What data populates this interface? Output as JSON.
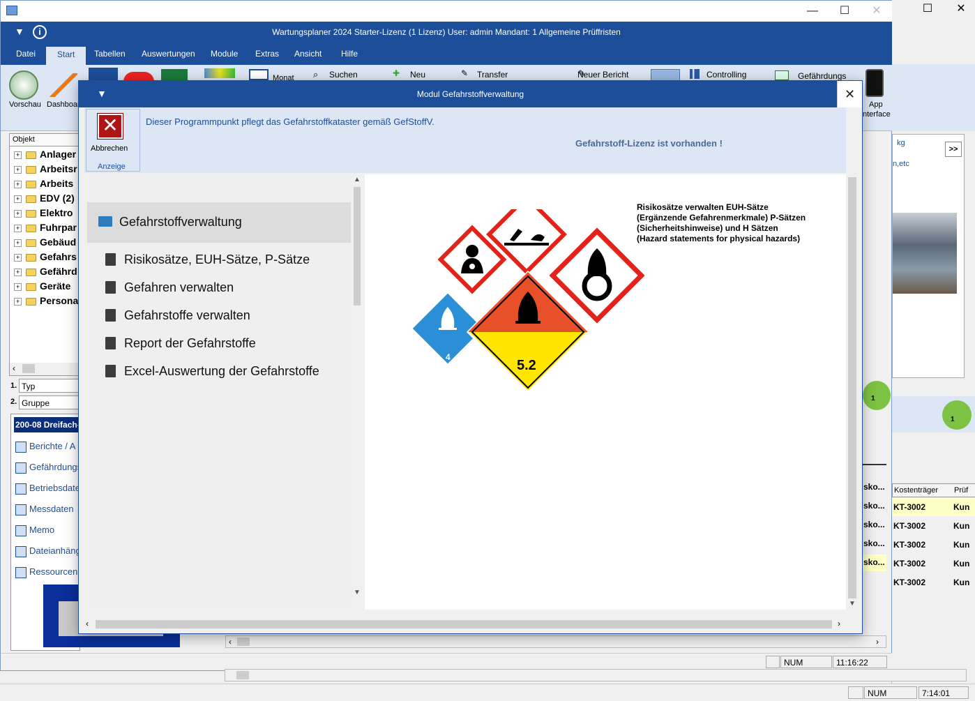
{
  "window": {
    "title": "Wartungsplaner 2024 Starter-Lizenz (1 Lizenz)   User: admin   Mandant: 1 Allgemeine Prüffristen"
  },
  "menu": [
    "Datei",
    "Start",
    "Tabellen",
    "Auswertungen",
    "Module",
    "Extras",
    "Ansicht",
    "Hilfe"
  ],
  "ribbon": {
    "vorschau": "Vorschau",
    "dashboard": "Dashboar",
    "monat": "Monat",
    "suchen": "Suchen",
    "neu": "Neu",
    "transfer": "Transfer",
    "neuer_bericht": "Neuer Bericht",
    "controlling": "Controlling",
    "gefaehrdungs": "Gefährdungs",
    "app": "App",
    "interface": "nterface"
  },
  "tree": {
    "header": "Objekt",
    "items": [
      "Anlager",
      "Arbeitsr",
      "Arbeits",
      "EDV  (2)",
      "Elektro",
      "Fuhrpar",
      "Gebäud",
      "Gefahrs",
      "Gefährd",
      "Geräte",
      "Persona"
    ]
  },
  "filters": {
    "label1": "1.",
    "value1": "Typ",
    "label2": "2.",
    "value2": "Gruppe"
  },
  "nav": {
    "header": "200-08 Dreifach-",
    "items": [
      "Berichte / A",
      "Gefährdungs",
      "Betriebsdate",
      "Messdaten",
      "Memo",
      "Dateianhäng",
      "Ressourcen"
    ]
  },
  "right_panel": {
    "kg": "kg",
    "etc": "n,etc",
    "expand": ">>",
    "grid_prefix": [
      "sko...",
      "sko...",
      "sko...",
      "sko...",
      "sko..."
    ],
    "col_kosten": "Kostenträger",
    "col_pruef": "Prüf",
    "rows": [
      {
        "kt": "KT-3002",
        "k": "Kun"
      },
      {
        "kt": "KT-3002",
        "k": "Kun"
      },
      {
        "kt": "KT-3002",
        "k": "Kun"
      },
      {
        "kt": "KT-3002",
        "k": "Kun"
      },
      {
        "kt": "KT-3002",
        "k": "Kun"
      }
    ],
    "badge": "1"
  },
  "status": {
    "num": "NUM",
    "time": "11:16:22",
    "num_bg": "NUM",
    "time_bg": "7:14:01"
  },
  "modal": {
    "title": "Modul Gefahrstoffverwaltung",
    "cancel_label": "Abbrechen",
    "group_label": "Anzeige",
    "info": "Dieser Programmpunkt pflegt das Gefahrstoffkataster gemäß GefStoffV.",
    "license": "Gefahrstoff-Lizenz ist vorhanden !",
    "heading": "Gefahrstoffverwaltung",
    "items": [
      "Risikosätze, EUH-Sätze, P-Sätze",
      "Gefahren verwalten",
      "Gefahrstoffe verwalten",
      "Report der Gefahrstoffe",
      "Excel-Auswertung der Gefahrstoffe"
    ],
    "hazard_text": [
      "Risikosätze verwalten  EUH-Sätze",
      "(Ergänzende Gefahrenmerkmale) P-Sätzen",
      "(Sicherheitshinweise) und H Sätzen",
      "(Hazard statements for physical hazards)"
    ],
    "sign_4": "4",
    "sign_52": "5.2"
  },
  "colors": {
    "brand_blue": "#1d4e9a",
    "ribbon": "#dce6f4",
    "hazard_red": "#e2231a",
    "hazard_blue": "#2a8fd6",
    "hazard_yellow": "#ffe600",
    "hazard_orange": "#e8502a"
  }
}
